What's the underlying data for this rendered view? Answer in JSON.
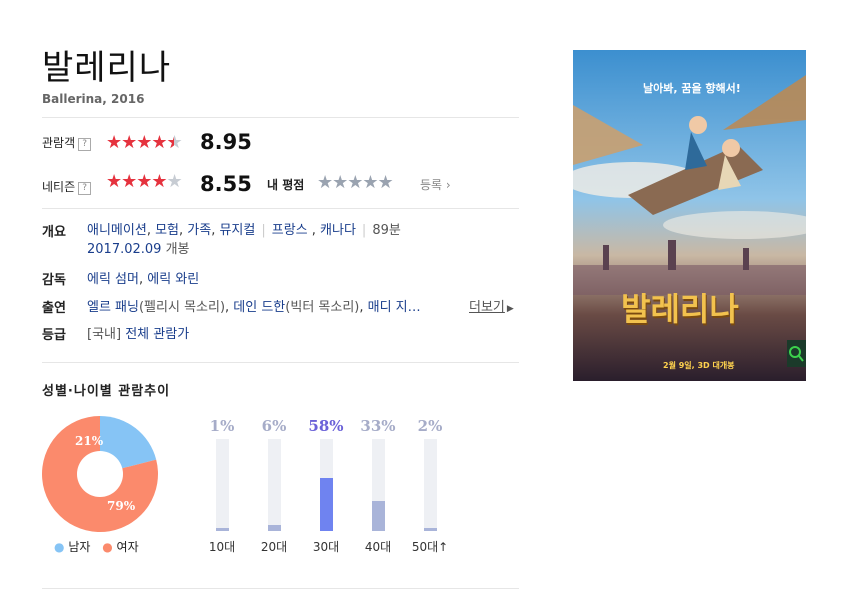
{
  "movie": {
    "title": "발레리나",
    "subtitle": "Ballerina, 2016"
  },
  "ratings": {
    "audience": {
      "label": "관람객",
      "help": "?",
      "score": "8.95",
      "stars_value": 4.5
    },
    "netizen": {
      "label": "네티즌",
      "help": "?",
      "score": "8.55",
      "stars_value": 4.25
    },
    "my_rating": {
      "label": "내 평점",
      "register_label": "등록"
    }
  },
  "info": {
    "overview_label": "개요",
    "genres": [
      "애니메이션",
      "모험",
      "가족",
      "뮤지컬"
    ],
    "countries": [
      "프랑스",
      "캐나다"
    ],
    "runtime": "89분",
    "release": "2017.02.09",
    "release_suffix": " 개봉",
    "director_label": "감독",
    "directors": [
      "에릭 섬머",
      "에릭 와린"
    ],
    "cast_label": "출연",
    "cast": [
      {
        "name": "엘르 패닝",
        "role": "(펠리시 목소리)"
      },
      {
        "name": "데인 드한",
        "role": "(빅터 목소리)"
      },
      {
        "name": "매디 지…",
        "role": ""
      }
    ],
    "more_label": "더보기",
    "grade_label": "등급",
    "grade_prefix": "[국내]",
    "grade": "전체 관람가"
  },
  "poster": {
    "tagline": "날아봐, 꿈을 향해서!",
    "logo_text": "발레리나",
    "release_note": "2월 9일, 3D 대개봉"
  },
  "demographics": {
    "title": "성별·나이별 관람추이",
    "gender": [
      {
        "label": "남자",
        "percent": 21,
        "display": "21%",
        "color": "#86c4f5"
      },
      {
        "label": "여자",
        "percent": 79,
        "display": "79%",
        "color": "#fb8a6c"
      }
    ],
    "age": [
      {
        "label": "10대",
        "display": "1%",
        "value": 1,
        "highlight": false
      },
      {
        "label": "20대",
        "display": "6%",
        "value": 6,
        "highlight": false
      },
      {
        "label": "30대",
        "display": "58%",
        "value": 58,
        "highlight": true
      },
      {
        "label": "40대",
        "display": "33%",
        "value": 33,
        "highlight": false
      },
      {
        "label": "50대↑",
        "display": "2%",
        "value": 2,
        "highlight": false
      }
    ],
    "colors": {
      "bar": "#a9b4d9",
      "bar_highlight": "#6f83f0",
      "pct": "#a6acc8",
      "pct_highlight": "#6b62d8"
    }
  }
}
